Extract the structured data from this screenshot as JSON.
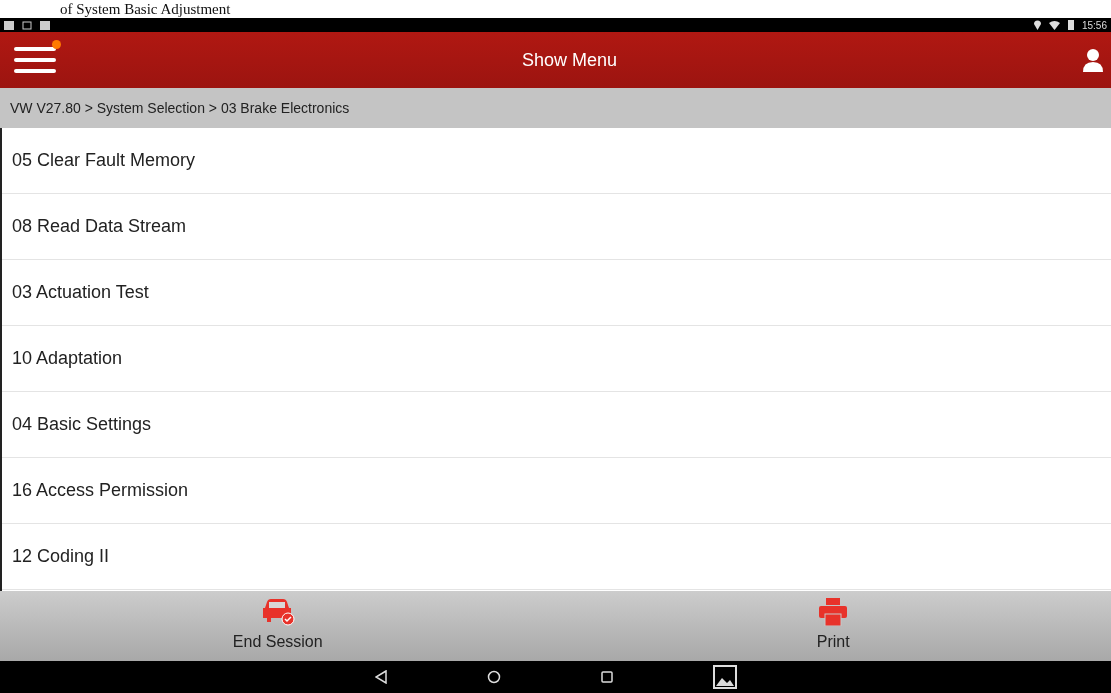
{
  "caption": "of System Basic Adjustment",
  "status_bar": {
    "time": "15:56"
  },
  "header": {
    "title": "Show Menu",
    "notification": true
  },
  "breadcrumb": "VW V27.80 > System Selection > 03 Brake Electronics",
  "menu_items": [
    {
      "label": "05 Clear Fault Memory"
    },
    {
      "label": "08 Read Data Stream"
    },
    {
      "label": "03 Actuation Test"
    },
    {
      "label": "10 Adaptation"
    },
    {
      "label": "04 Basic Settings"
    },
    {
      "label": "16 Access Permission"
    },
    {
      "label": "12 Coding II"
    }
  ],
  "bottom_actions": [
    {
      "kind": "end-session",
      "label": "End Session"
    },
    {
      "kind": "print",
      "label": "Print"
    }
  ]
}
